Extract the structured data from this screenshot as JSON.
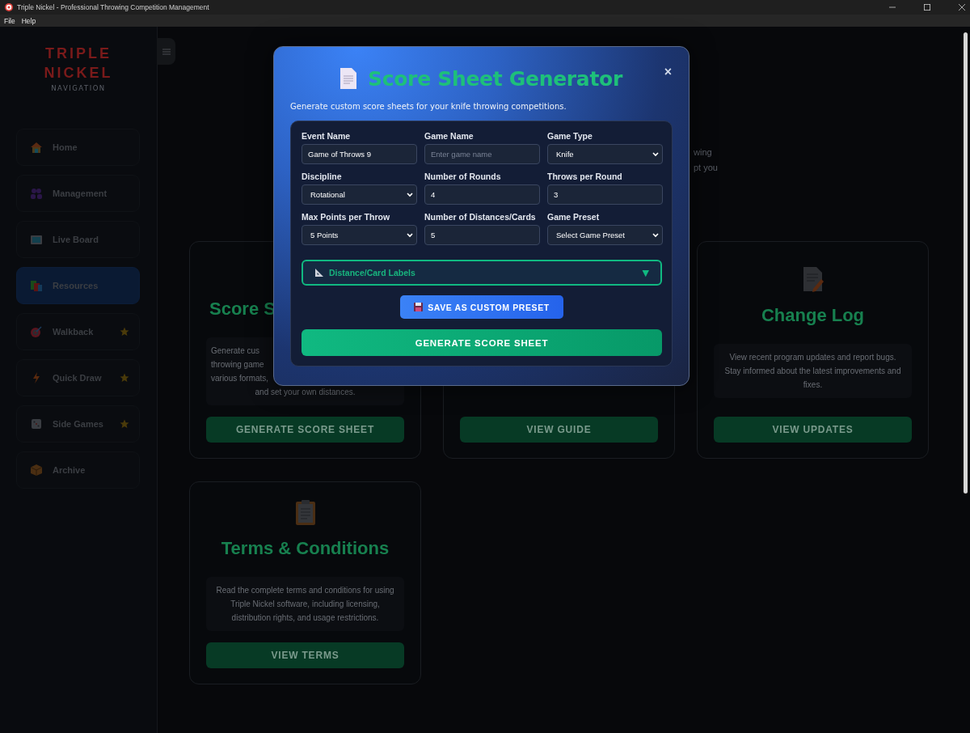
{
  "window": {
    "title": "Triple Nickel - Professional Throwing Competition Management"
  },
  "menu": [
    "File",
    "Help"
  ],
  "sidebar": {
    "logo_lines": [
      "TRIPLE",
      "NICKEL"
    ],
    "subtitle": "NAVIGATION",
    "items": [
      {
        "label": "Home",
        "selected": false,
        "starred": false
      },
      {
        "label": "Management",
        "selected": false,
        "starred": false
      },
      {
        "label": "Live Board",
        "selected": false,
        "starred": false
      },
      {
        "label": "Resources",
        "selected": true,
        "starred": false
      },
      {
        "label": "Walkback",
        "selected": false,
        "starred": true
      },
      {
        "label": "Quick Draw",
        "selected": false,
        "starred": true
      },
      {
        "label": "Side Games",
        "selected": false,
        "starred": true
      },
      {
        "label": "Archive",
        "selected": false,
        "starred": false
      }
    ]
  },
  "main": {
    "intro_fragments": [
      "wing",
      "pt you"
    ],
    "cards": [
      {
        "title": "Score S",
        "title_clipped": true,
        "description": [
          {
            "text": "Generate cus",
            "clipped": true
          },
          {
            "text": "throwing game",
            "clipped": true
          },
          {
            "text": "various formats,",
            "clipped": true
          },
          {
            "text": "and set your own distances.",
            "clipped": false
          }
        ],
        "button": "GENERATE SCORE SHEET"
      },
      {
        "button": "VIEW GUIDE"
      },
      {
        "title": "Change Log",
        "title_clipped": false,
        "description": [
          {
            "text": "View recent program updates and report bugs. Stay informed about the latest improvements and fixes.",
            "clipped": false
          }
        ],
        "button": "VIEW UPDATES"
      },
      {
        "title": "Terms & Conditions",
        "title_clipped": false,
        "description": [
          {
            "text": "Read the complete terms and conditions for using Triple Nickel software, including licensing, distribution rights, and usage restrictions.",
            "clipped": false
          }
        ],
        "button": "VIEW TERMS"
      }
    ]
  },
  "modal": {
    "title": "Score Sheet Generator",
    "close": "×",
    "subtitle": "Generate custom score sheets for your knife throwing competitions.",
    "fields": [
      {
        "label": "Event Name",
        "kind": "text",
        "value": "Game of Throws 9"
      },
      {
        "label": "Game Name",
        "kind": "text",
        "placeholder": "Enter game name"
      },
      {
        "label": "Game Type",
        "kind": "select",
        "value": "Knife"
      },
      {
        "label": "Discipline",
        "kind": "select",
        "value": "Rotational"
      },
      {
        "label": "Number of Rounds",
        "kind": "text",
        "value": "4"
      },
      {
        "label": "Throws per Round",
        "kind": "text",
        "value": "3"
      },
      {
        "label": "Max Points per Throw",
        "kind": "select",
        "value": "5 Points"
      },
      {
        "label": "Number of Distances/Cards",
        "kind": "text",
        "value": "5"
      },
      {
        "label": "Game Preset",
        "kind": "select",
        "value": "Select Game Preset"
      }
    ],
    "labels_toggle": {
      "label": "Distance/Card Labels",
      "expanded": false,
      "arrow": "▼"
    },
    "save_button": "SAVE AS CUSTOM PRESET",
    "generate_button": "GENERATE SCORE SHEET"
  }
}
